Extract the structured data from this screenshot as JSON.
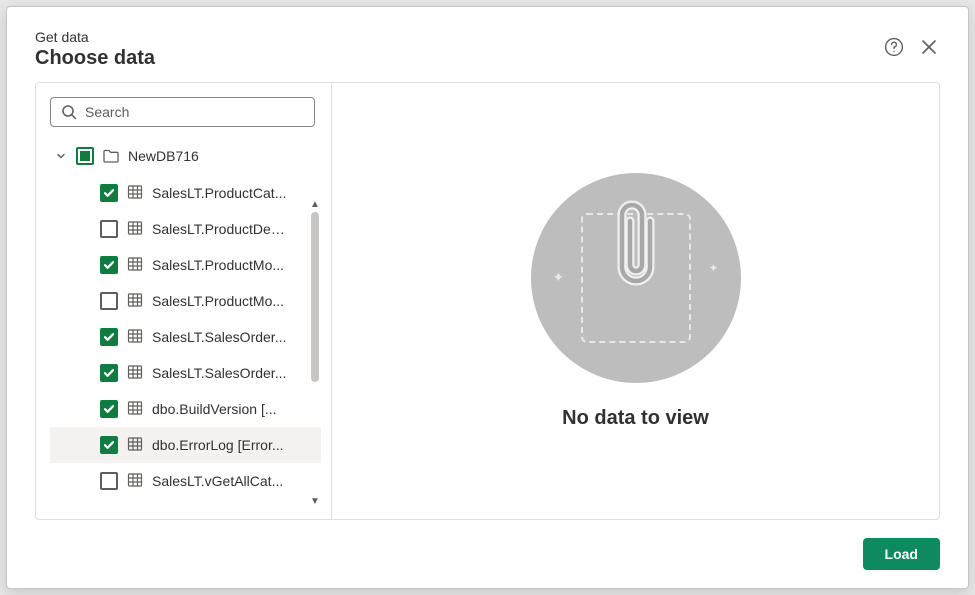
{
  "header": {
    "subtitle": "Get data",
    "title": "Choose data"
  },
  "search": {
    "placeholder": "Search",
    "value": ""
  },
  "tree": {
    "database": {
      "name": "NewDB716",
      "state": "partial",
      "expanded": true
    },
    "items": [
      {
        "label": "SalesLT.ProductCat...",
        "checked": true,
        "selected": false
      },
      {
        "label": "SalesLT.ProductDes...",
        "checked": false,
        "selected": false
      },
      {
        "label": "SalesLT.ProductMo...",
        "checked": true,
        "selected": false
      },
      {
        "label": "SalesLT.ProductMo...",
        "checked": false,
        "selected": false
      },
      {
        "label": "SalesLT.SalesOrder...",
        "checked": true,
        "selected": false
      },
      {
        "label": "SalesLT.SalesOrder...",
        "checked": true,
        "selected": false
      },
      {
        "label": "dbo.BuildVersion [...",
        "checked": true,
        "selected": false
      },
      {
        "label": "dbo.ErrorLog [Error...",
        "checked": true,
        "selected": true
      },
      {
        "label": "SalesLT.vGetAllCat...",
        "checked": false,
        "selected": false
      }
    ]
  },
  "preview": {
    "empty_message": "No data to view"
  },
  "footer": {
    "load_label": "Load"
  },
  "colors": {
    "accent": "#107c41",
    "primary_btn": "#0d8a5f"
  }
}
